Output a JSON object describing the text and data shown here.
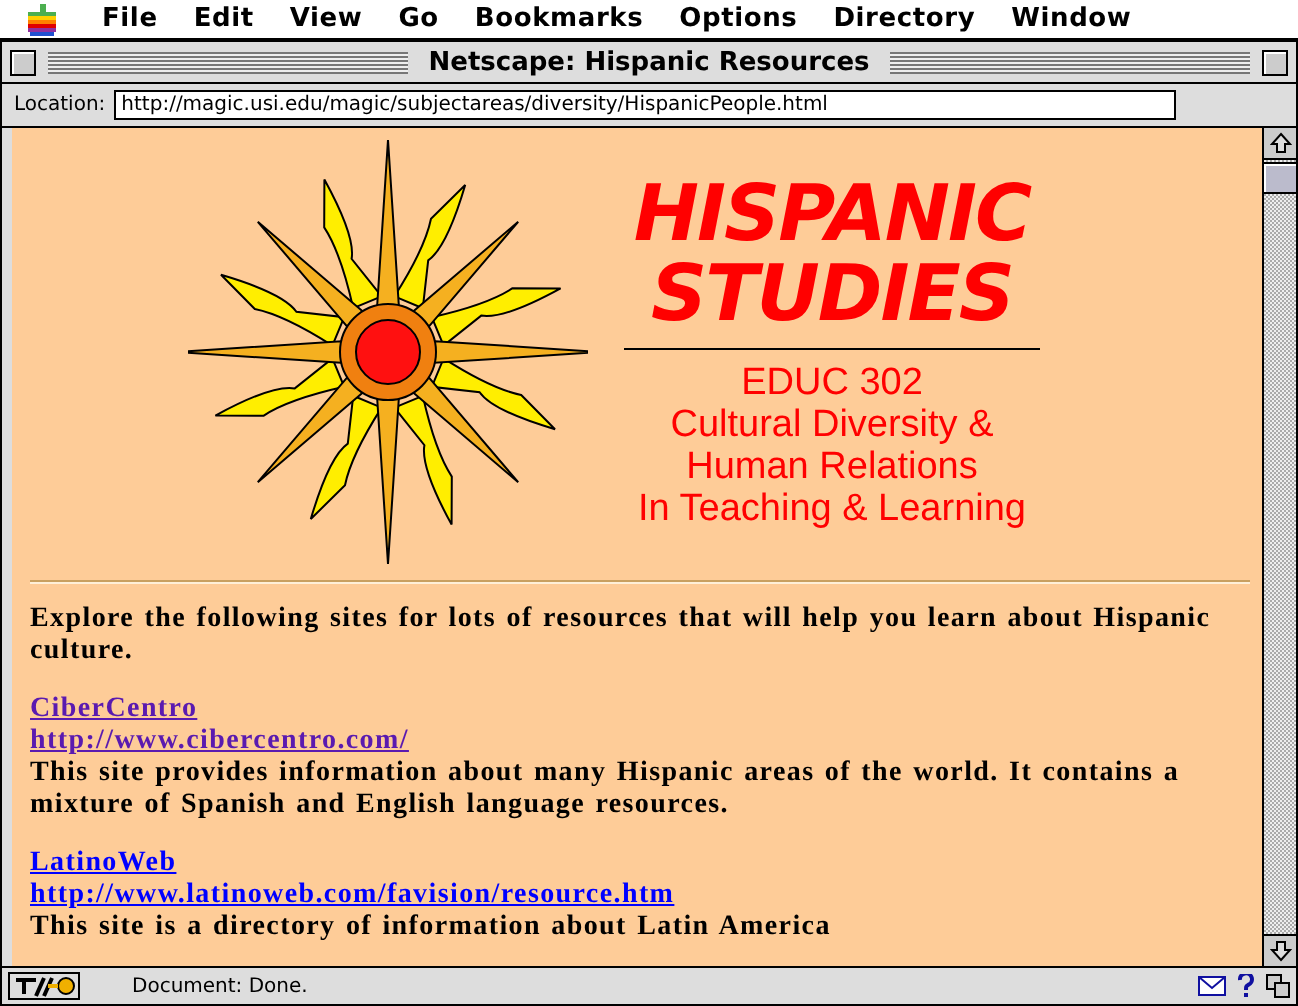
{
  "menu_bar": {
    "items": [
      "File",
      "Edit",
      "View",
      "Go",
      "Bookmarks",
      "Options",
      "Directory",
      "Window"
    ]
  },
  "window": {
    "title": "Netscape: Hispanic Resources"
  },
  "location": {
    "label": "Location:",
    "value": "http://magic.usi.edu/magic/subjectareas/diversity/HispanicPeople.html"
  },
  "banner": {
    "heading_lines": [
      "HISPANIC",
      "STUDIES"
    ],
    "subtitle_lines": [
      "EDUC 302",
      "Cultural Diversity &",
      "Human Relations",
      "In Teaching & Learning"
    ]
  },
  "intro": "Explore the following sites for lots of resources that will help you learn about Hispanic culture.",
  "sites": [
    {
      "name": "CiberCentro",
      "url": "http://www.cibercentro.com/",
      "visited": true,
      "description": "This site provides information about many Hispanic areas of the world. It contains a mixture of Spanish and English language resources."
    },
    {
      "name": "LatinoWeb",
      "url": "http://www.latinoweb.com/favision/resource.htm",
      "visited": false,
      "description": "This site is a directory of information about Latin America"
    }
  ],
  "status_bar": {
    "text": "Document: Done."
  }
}
